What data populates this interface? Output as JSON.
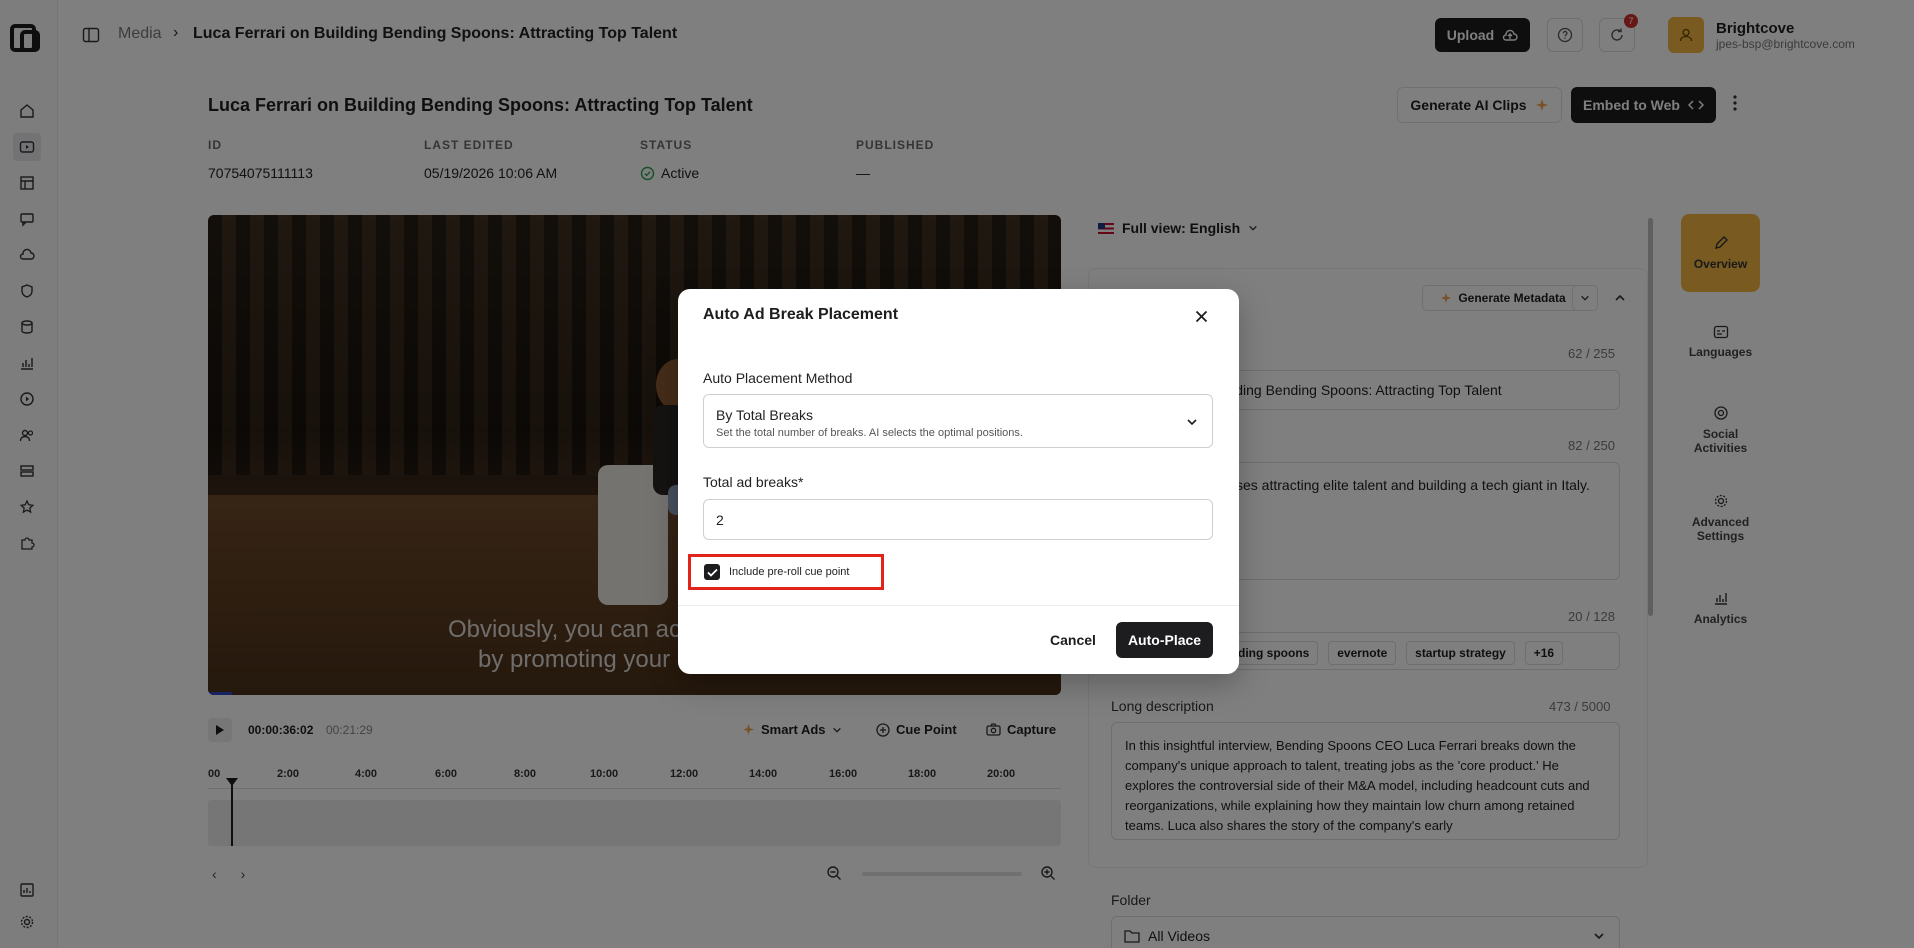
{
  "breadcrumb": {
    "root": "Media",
    "separator": "›",
    "current": "Luca Ferrari on Building Bending Spoons: Attracting Top Talent"
  },
  "topbar": {
    "upload_label": "Upload",
    "notification_count": "7",
    "account_name": "Brightcove",
    "account_email": "jpes-bsp@brightcove.com"
  },
  "page": {
    "title": "Luca Ferrari on Building Bending Spoons: Attracting Top Talent",
    "generate_clips_label": "Generate AI Clips",
    "embed_label": "Embed to Web"
  },
  "meta": {
    "id_label": "ID",
    "id_value": "70754075111113",
    "edited_label": "LAST EDITED",
    "edited_value": "05/19/2026 10:06 AM",
    "status_label": "STATUS",
    "status_value": "Active",
    "published_label": "PUBLISHED",
    "published_value": "—"
  },
  "player": {
    "caption_line1": "Obviously, you can ac",
    "caption_line2": "by promoting your",
    "current_time": "00:00:36:02",
    "total_time": "00:21:29",
    "smart_ads_label": "Smart Ads",
    "cue_point_label": "Cue Point",
    "capture_label": "Capture",
    "ticks": [
      "00",
      "2:00",
      "4:00",
      "6:00",
      "8:00",
      "10:00",
      "12:00",
      "14:00",
      "16:00",
      "18:00",
      "20:00"
    ]
  },
  "panel": {
    "language_label": "Full view: English",
    "generate_metadata_label": "Generate Metadata",
    "title_counter": "62 / 255",
    "title_value": "ilding Bending Spoons: Attracting Top Talent",
    "short_desc_counter": "82 / 250",
    "short_desc_value": "sses attracting elite talent and building a tech giant in Italy.",
    "tags_counter": "20 / 128",
    "tags": [
      "ding spoons",
      "evernote",
      "startup strategy",
      "+16"
    ],
    "long_desc_label": "Long description",
    "long_desc_counter": "473 / 5000",
    "long_desc_value": "In this insightful interview, Bending Spoons CEO Luca Ferrari breaks down the company's unique approach to talent, treating jobs as the 'core product.' He explores the controversial side of their M&A model, including headcount cuts and reorganizations, while explaining how they maintain low churn among retained teams. Luca also shares the story of the company's early",
    "folder_label": "Folder",
    "folder_value": "All Videos"
  },
  "side_tabs": [
    {
      "label": "Overview"
    },
    {
      "label": "Languages"
    },
    {
      "label": "Social Activities"
    },
    {
      "label": "Advanced Settings"
    },
    {
      "label": "Analytics"
    }
  ],
  "modal": {
    "title": "Auto Ad Break Placement",
    "method_label": "Auto Placement Method",
    "method_value": "By Total Breaks",
    "method_help": "Set the total number of breaks. AI selects the optimal positions.",
    "breaks_label": "Total ad breaks*",
    "breaks_value": "2",
    "preroll_label": "Include pre-roll cue point",
    "preroll_checked": true,
    "cancel_label": "Cancel",
    "submit_label": "Auto-Place"
  },
  "colors": {
    "accent": "#f2b744",
    "primary": "#1d1d1f",
    "highlight": "#e2231a",
    "status_ok": "#2e9e4f"
  }
}
